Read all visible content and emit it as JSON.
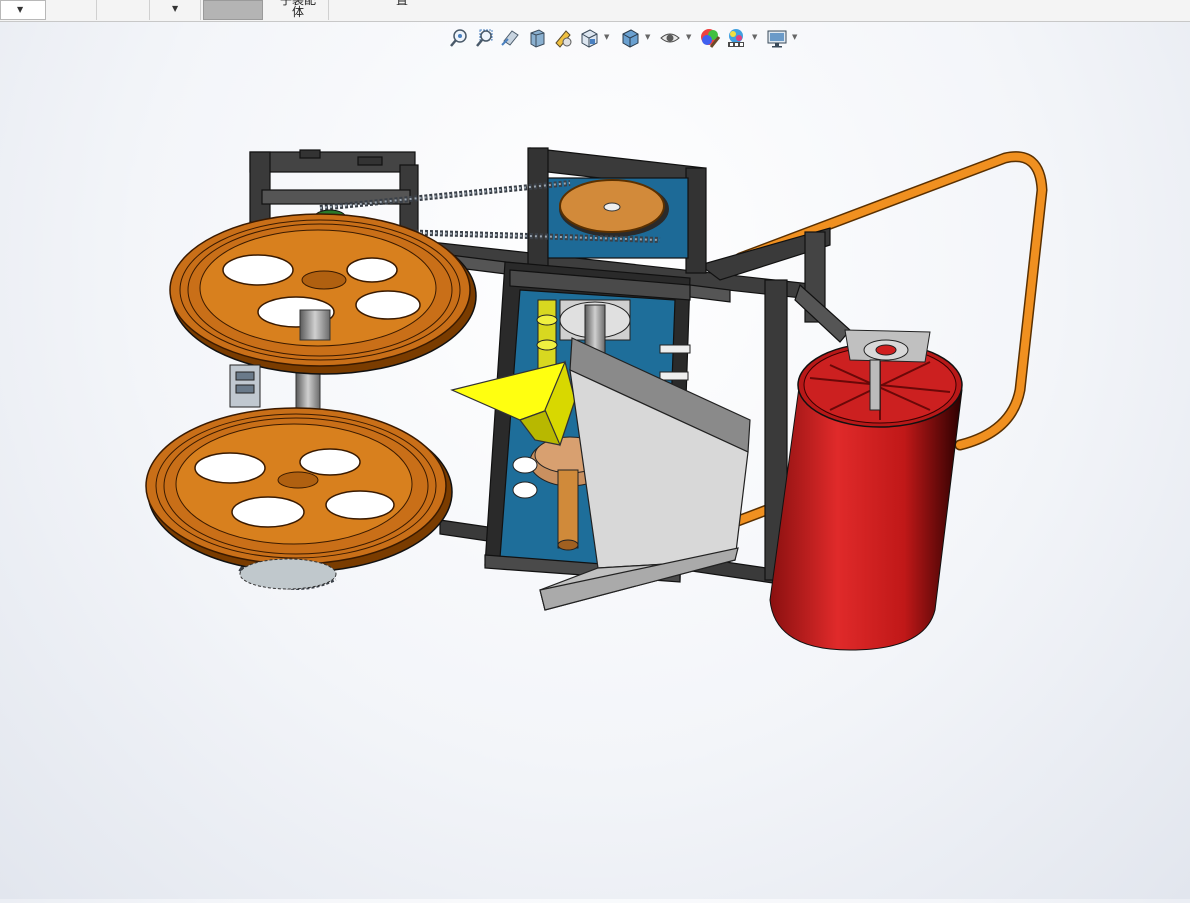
{
  "toolbar": {
    "cell_label_1": "子装配\n体",
    "cell_label_2": "置",
    "dropdown_value": ""
  },
  "heads_up_toolbar": {
    "buttons": [
      "zoom-to-fit-icon",
      "zoom-to-area-icon",
      "previous-view-icon",
      "section-view-icon",
      "dynamic-annotation-icon",
      "view-orientation-icon",
      "display-style-icon",
      "hide-show-items-icon",
      "edit-appearance-icon",
      "apply-scene-icon",
      "view-settings-icon"
    ]
  },
  "colors": {
    "frame": "#3a3a3a",
    "wheel": "#c8701a",
    "tank": "#cc2222",
    "pipe": "#e08a1a",
    "funnel": "#f0f000",
    "plate": "#c0c0c0",
    "inner_blue": "#1e6e9a"
  }
}
